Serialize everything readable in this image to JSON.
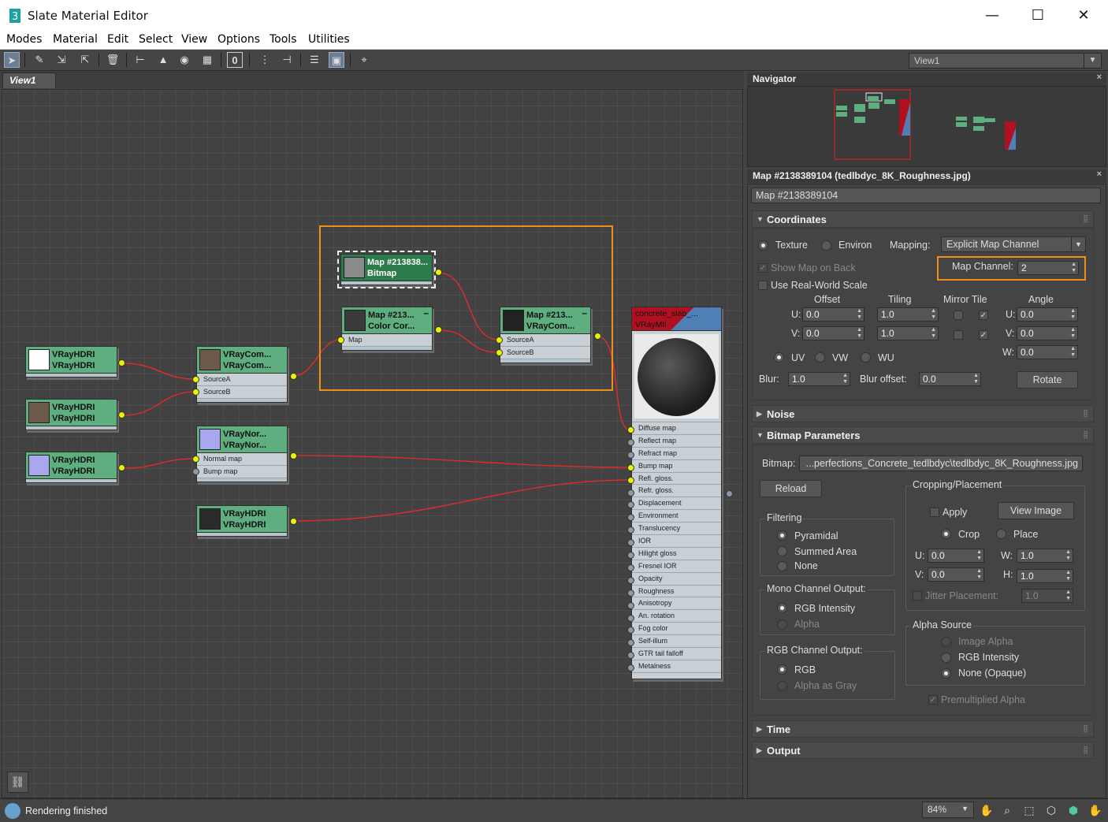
{
  "window": {
    "title": "Slate Material Editor",
    "minimize": "—",
    "maximize": "☐",
    "close": "✕"
  },
  "menu": [
    "Modes",
    "Material",
    "Edit",
    "Select",
    "View",
    "Options",
    "Tools",
    "Utilities"
  ],
  "toolbar": {
    "view_selector": "View1",
    "count_field": "0"
  },
  "view_tab": "View1",
  "nodes": {
    "hdri1": {
      "l1": "VRayHDRI",
      "l2": "VRayHDRI"
    },
    "hdri2": {
      "l1": "VRayHDRI",
      "l2": "VRayHDRI"
    },
    "hdri3": {
      "l1": "VRayHDRI",
      "l2": "VRayHDRI"
    },
    "hdri4": {
      "l1": "VRayHDRI",
      "l2": "VRayHDRI"
    },
    "comp1": {
      "l1": "VRayCom...",
      "l2": "VRayCom...",
      "slot_a": "SourceA",
      "slot_b": "SourceB"
    },
    "normal": {
      "l1": "VRayNor...",
      "l2": "VRayNor...",
      "slot_a": "Normal map",
      "slot_b": "Bump map"
    },
    "bitmap": {
      "l1": "Map #213838...",
      "l2": "Bitmap"
    },
    "colorcor": {
      "l1": "Map #213...",
      "l2": "Color Cor...",
      "slot_a": "Map"
    },
    "comp2": {
      "l1": "Map #213...",
      "l2": "VRayCom...",
      "slot_a": "SourceA",
      "slot_b": "SourceB"
    },
    "material": {
      "l1": "concrete_slab_...",
      "l2": "VRayMtl",
      "slots": [
        "Diffuse map",
        "Reflect map",
        "Refract map",
        "Bump map",
        "Refl. gloss.",
        "Refr. gloss.",
        "Displacement",
        "Environment",
        "Translucency",
        "IOR",
        "Hilight gloss",
        "Fresnel IOR",
        "Opacity",
        "Roughness",
        "Anisotropy",
        "An. rotation",
        "Fog color",
        "Self-illum",
        "GTR tail falloff",
        "Metalness"
      ]
    }
  },
  "navigator": {
    "title": "Navigator",
    "close": "×"
  },
  "params": {
    "header": "Map #2138389104 (tedlbdyc_8K_Roughness.jpg)",
    "close": "×",
    "name_field": "Map #2138389104",
    "coordinates": {
      "title": "Coordinates",
      "texture": "Texture",
      "environ": "Environ",
      "mapping_label": "Mapping:",
      "mapping_value": "Explicit Map Channel",
      "show_map": "Show Map on Back",
      "map_channel_label": "Map Channel:",
      "map_channel_value": "2",
      "real_world": "Use Real-World Scale",
      "col_offset": "Offset",
      "col_tiling": "Tiling",
      "col_mirror": "Mirror Tile",
      "col_angle": "Angle",
      "u": "U:",
      "v": "V:",
      "w": "W:",
      "offset_u": "0.0",
      "offset_v": "0.0",
      "tiling_u": "1.0",
      "tiling_v": "1.0",
      "angle_u": "0.0",
      "angle_v": "0.0",
      "angle_w": "0.0",
      "uv": "UV",
      "vw": "VW",
      "wu": "WU",
      "blur_label": "Blur:",
      "blur_value": "1.0",
      "blur_offset_label": "Blur offset:",
      "blur_offset_value": "0.0",
      "rotate": "Rotate"
    },
    "noise": "Noise",
    "bitmap_params": {
      "title": "Bitmap Parameters",
      "bitmap_label": "Bitmap:",
      "bitmap_path": "...perfections_Concrete_tedlbdyc\\tedlbdyc_8K_Roughness.jpg",
      "reload": "Reload",
      "filtering": "Filtering",
      "pyramidal": "Pyramidal",
      "summed": "Summed Area",
      "none": "None",
      "mono": "Mono Channel Output:",
      "rgb_intensity": "RGB Intensity",
      "alpha": "Alpha",
      "rgb_out": "RGB Channel Output:",
      "rgb": "RGB",
      "alpha_gray": "Alpha as Gray",
      "cropping": "Cropping/Placement",
      "apply": "Apply",
      "view_image": "View Image",
      "crop": "Crop",
      "place": "Place",
      "u": "U:",
      "v": "V:",
      "w": "W:",
      "h": "H:",
      "crop_u": "0.0",
      "crop_v": "0.0",
      "crop_w": "1.0",
      "crop_h": "1.0",
      "jitter": "Jitter Placement:",
      "jitter_value": "1.0",
      "alpha_source": "Alpha Source",
      "image_alpha": "Image Alpha",
      "rgb_intensity2": "RGB Intensity",
      "none_opaque": "None (Opaque)",
      "premult": "Premultiplied Alpha"
    },
    "time": "Time",
    "output": "Output"
  },
  "status": {
    "text": "Rendering finished",
    "zoom": "84%"
  }
}
